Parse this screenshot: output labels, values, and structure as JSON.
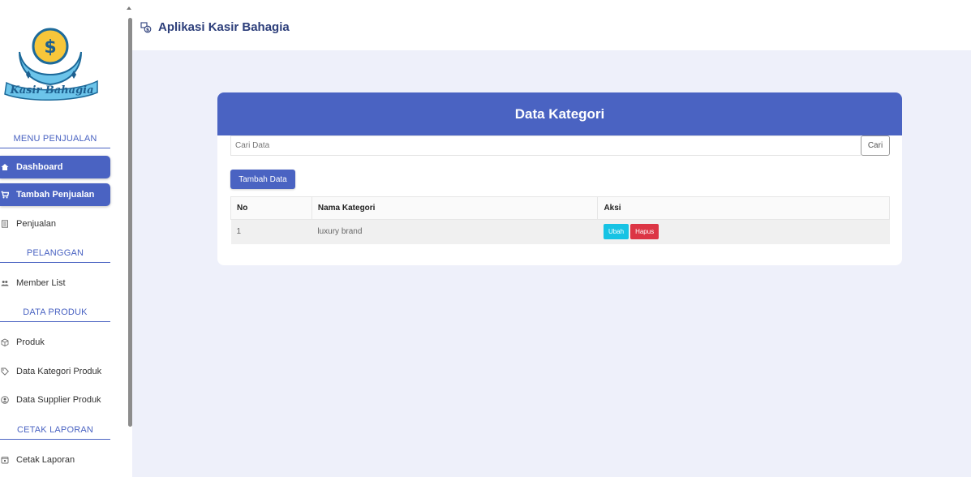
{
  "app": {
    "title": "Aplikasi Kasir Bahagia"
  },
  "logo": {
    "text": "Kasir Bahagia"
  },
  "sidebar": {
    "sections": [
      {
        "title": "MENU PENJUALAN"
      },
      {
        "title": "PELANGGAN"
      },
      {
        "title": "DATA PRODUK"
      },
      {
        "title": "CETAK LAPORAN"
      }
    ],
    "items": [
      {
        "label": "Dashboard",
        "icon": "home-icon",
        "active": true
      },
      {
        "label": "Tambah Penjualan",
        "icon": "cart-icon",
        "active": true
      },
      {
        "label": "Penjualan",
        "icon": "receipt-icon",
        "active": false
      },
      {
        "label": "Member List",
        "icon": "users-icon",
        "active": false
      },
      {
        "label": "Produk",
        "icon": "box-icon",
        "active": false
      },
      {
        "label": "Data Kategori Produk",
        "icon": "tag-icon",
        "active": false
      },
      {
        "label": "Data Supplier Produk",
        "icon": "supplier-icon",
        "active": false
      },
      {
        "label": "Cetak Laporan",
        "icon": "print-icon",
        "active": false
      }
    ]
  },
  "card": {
    "title": "Data Kategori",
    "search_placeholder": "Cari Data",
    "search_button": "Cari",
    "add_button": "Tambah Data",
    "table": {
      "columns": [
        "No",
        "Nama Kategori",
        "Aksi"
      ],
      "rows": [
        {
          "no": "1",
          "nama": "luxury brand",
          "edit_label": "Ubah",
          "delete_label": "Hapus"
        }
      ]
    }
  },
  "colors": {
    "primary": "#4a63c2",
    "background": "#eef0fa",
    "edit": "#17c3e4",
    "delete": "#dc3545"
  }
}
